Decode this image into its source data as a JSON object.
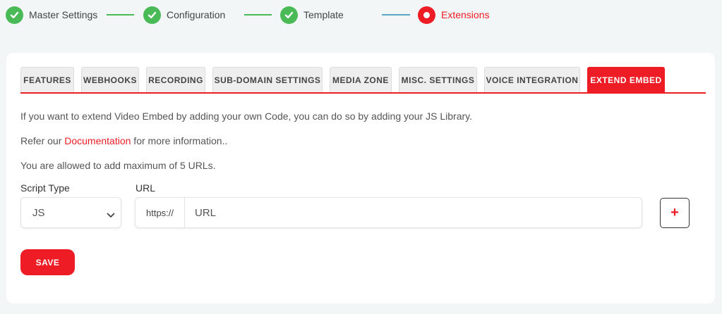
{
  "stepper": {
    "steps": [
      {
        "label": "Master Settings",
        "status": "done"
      },
      {
        "label": "Configuration",
        "status": "done"
      },
      {
        "label": "Template",
        "status": "done"
      },
      {
        "label": "Extensions",
        "status": "active"
      }
    ],
    "colors": {
      "done": "#4aba57",
      "active": "#ee1c25",
      "connector_last": "#5aa7c2"
    }
  },
  "tabs": [
    {
      "label": "FEATURES",
      "active": false
    },
    {
      "label": "WEBHOOKS",
      "active": false
    },
    {
      "label": "RECORDING",
      "active": false
    },
    {
      "label": "SUB-DOMAIN SETTINGS",
      "active": false
    },
    {
      "label": "MEDIA ZONE",
      "active": false
    },
    {
      "label": "MISC. SETTINGS",
      "active": false
    },
    {
      "label": "VOICE INTEGRATION",
      "active": false
    },
    {
      "label": "EXTEND EMBED",
      "active": true
    }
  ],
  "content": {
    "intro": "If you want to extend Video Embed by adding your own Code, you can do so by adding your JS Library.",
    "refer_prefix": "Refer our ",
    "refer_link": "Documentation",
    "refer_suffix": " for more information..",
    "limit_text": "You are allowed to add maximum of 5 URLs."
  },
  "form": {
    "script_type_label": "Script Type",
    "script_type_value": "JS",
    "url_label": "URL",
    "url_prefix": "https://",
    "url_placeholder": "URL",
    "url_value": "",
    "add_label": "+",
    "save_label": "SAVE"
  },
  "theme": {
    "accent": "#ee1c25",
    "success": "#4aba57",
    "background": "#f2f6f6"
  }
}
